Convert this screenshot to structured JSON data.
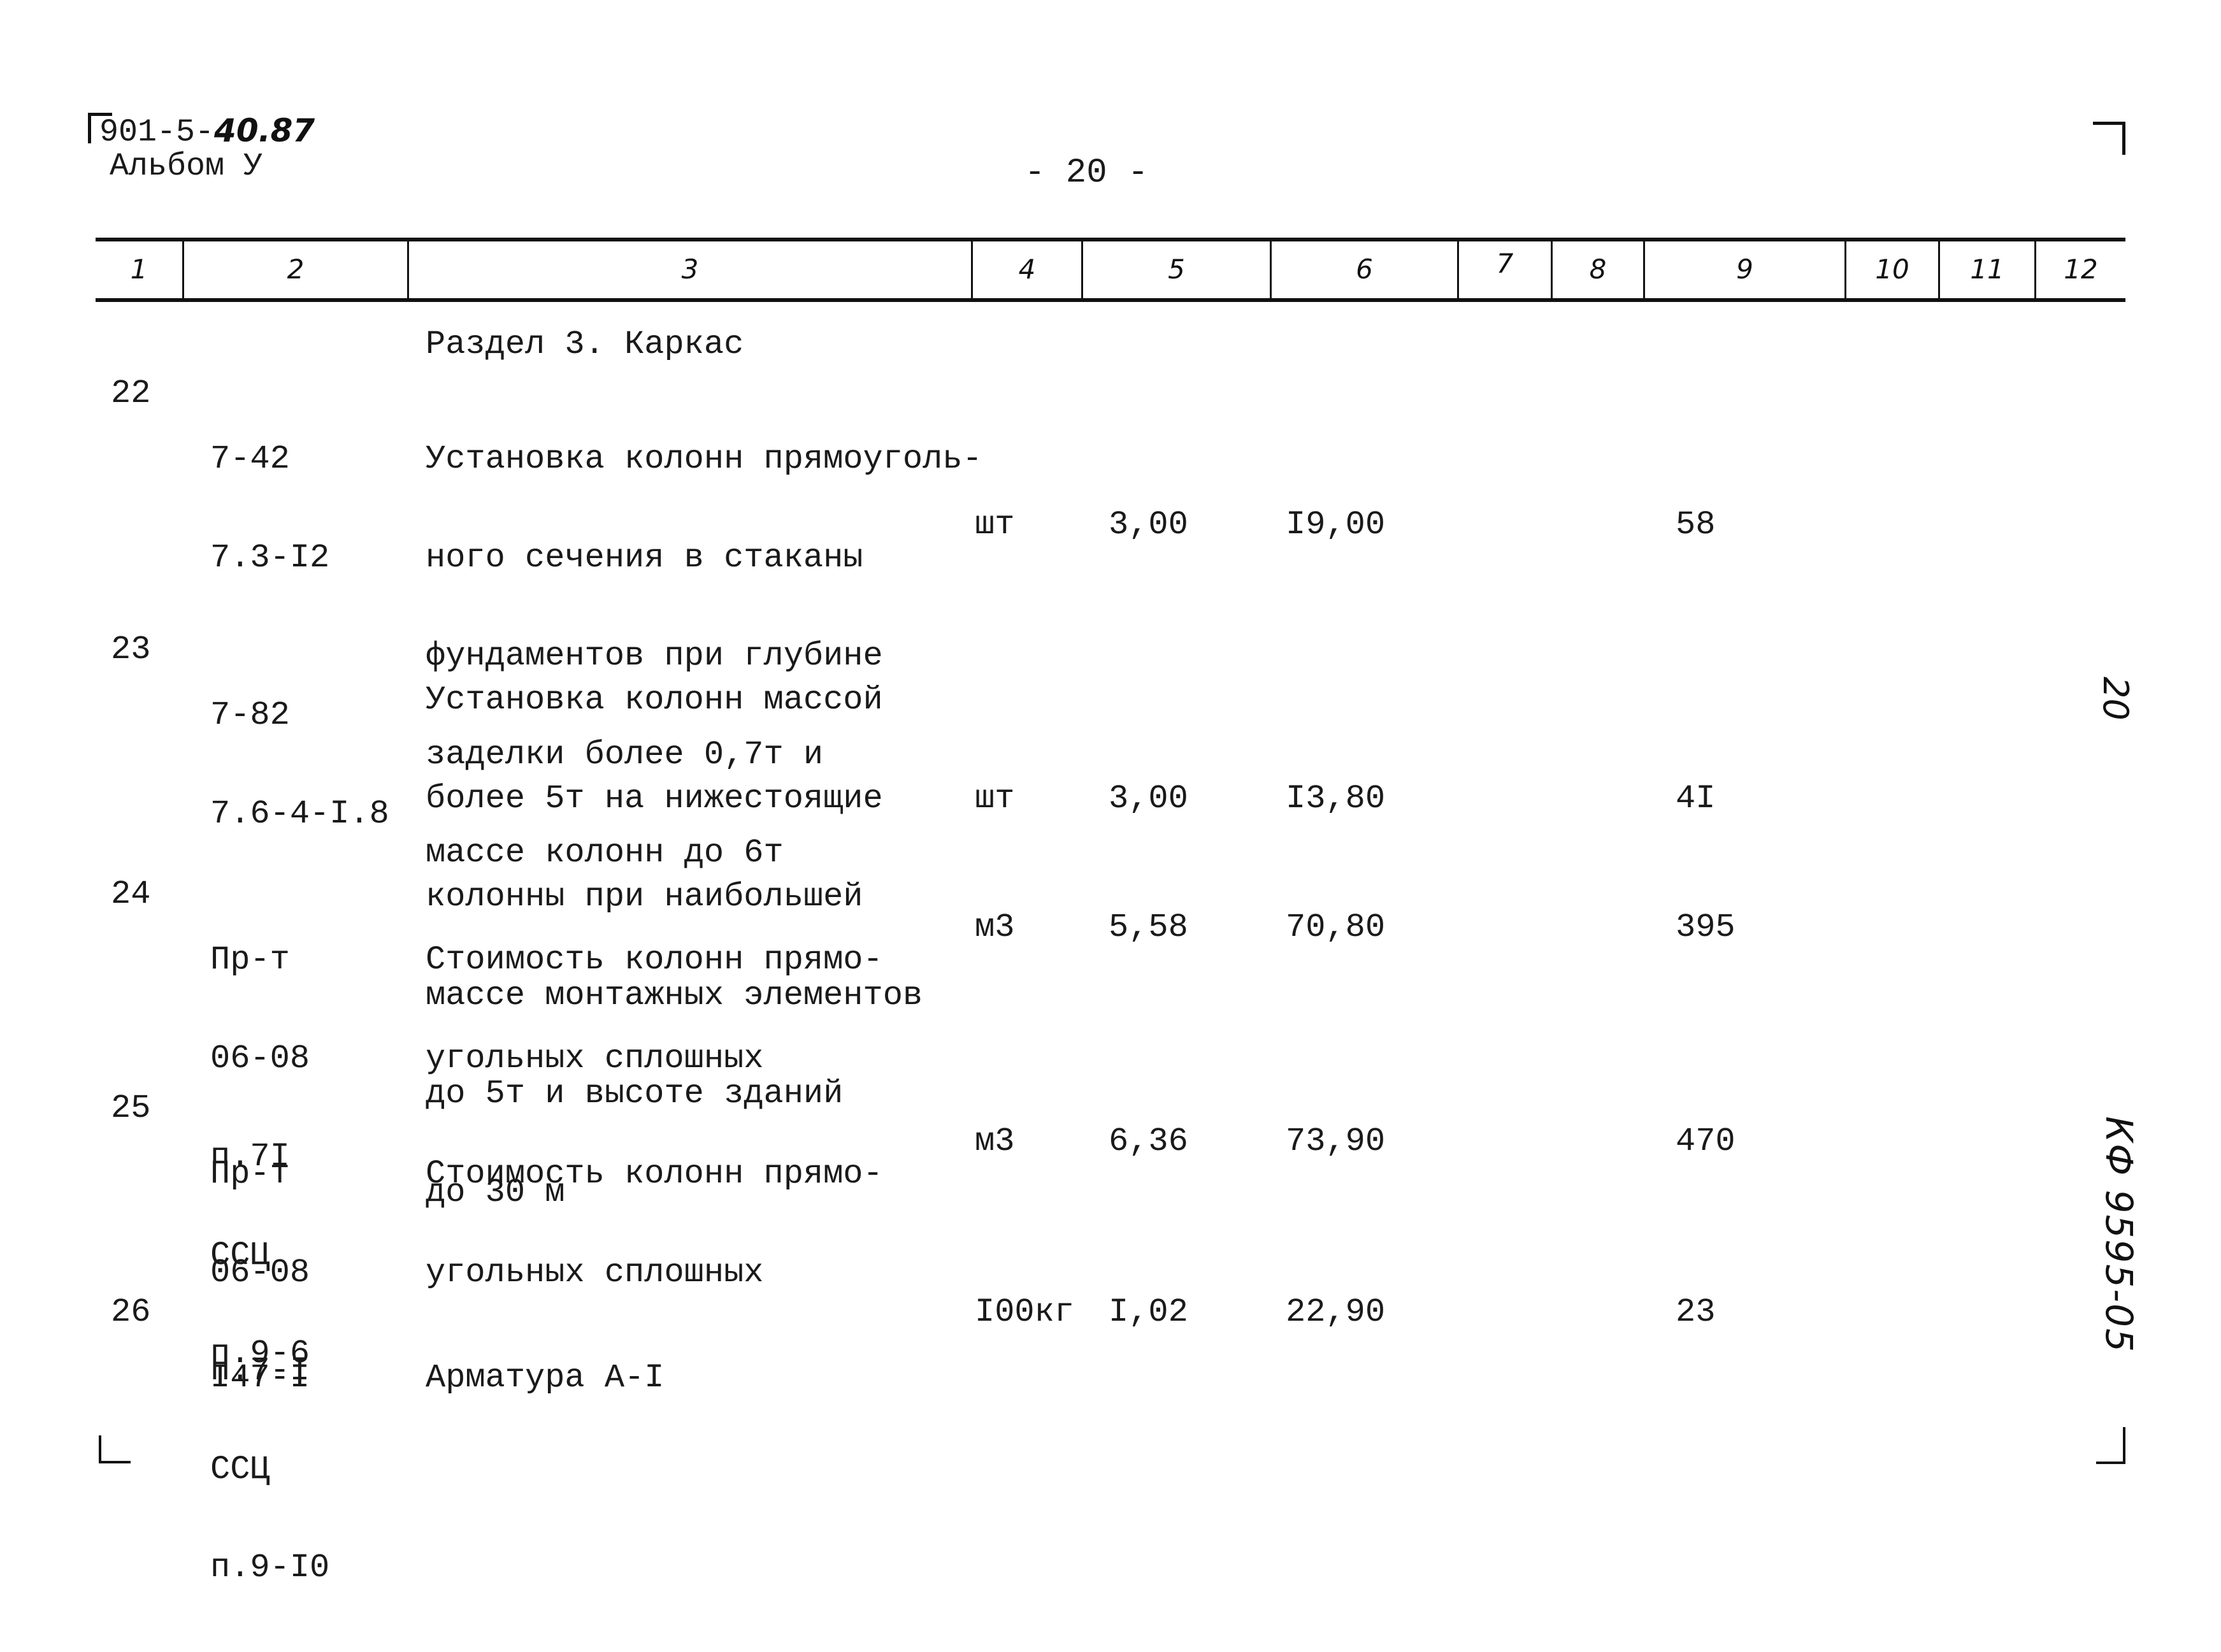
{
  "header": {
    "doc_code_printed": "901-5-",
    "doc_code_handwritten": "40.87",
    "album": "Альбом У",
    "page_number": "- 20 -"
  },
  "table": {
    "column_numbers": [
      "1",
      "2",
      "3",
      "4",
      "5",
      "6",
      "7",
      "8",
      "9",
      "10",
      "11",
      "12"
    ],
    "section_title": "Раздел 3. Каркас",
    "rows": [
      {
        "num": "22",
        "code": [
          "7-42",
          "7.3-I2"
        ],
        "description": [
          "Установка колонн прямоуголь-",
          "ного сечения в стаканы",
          "фундаментов при глубине",
          "заделки более 0,7т и",
          "массе колонн до 6т"
        ],
        "unit": "шт",
        "quantity": "3,00",
        "price": "I9,00",
        "col9": "58"
      },
      {
        "num": "23",
        "code": [
          "7-82",
          "7.6-4-I.8"
        ],
        "description": [
          "Установка колонн массой",
          "более 5т на нижестоящие",
          "колонны при наибольшей",
          "массе монтажных элементов",
          "до 5т и высоте зданий",
          "до 30 м"
        ],
        "unit": "шт",
        "quantity": "3,00",
        "price": "I3,80",
        "col9": "4I"
      },
      {
        "num": "24",
        "code": [
          "Пр-т",
          "06-08",
          "п.7I",
          "ССЦ",
          "п.9-6"
        ],
        "description": [
          "Стоимость колонн прямо-",
          "угольных сплошных"
        ],
        "unit": "м3",
        "quantity": "5,58",
        "price": "70,80",
        "col9": "395"
      },
      {
        "num": "25",
        "code": [
          "Пр-т",
          "06-08",
          "п.7-I",
          "ССЦ",
          "п.9-I0"
        ],
        "description": [
          "Стоимость колонн прямо-",
          "угольных сплошных"
        ],
        "unit": "м3",
        "quantity": "6,36",
        "price": "73,90",
        "col9": "470"
      },
      {
        "num": "26",
        "code": [
          "I47-I"
        ],
        "description": [
          "Арматура А-I"
        ],
        "unit": "I00кг",
        "quantity": "I,02",
        "price": "22,90",
        "col9": "23"
      }
    ]
  },
  "margin_notes": {
    "sheet_number": "20",
    "archive_code": "КФ 9595-05"
  }
}
